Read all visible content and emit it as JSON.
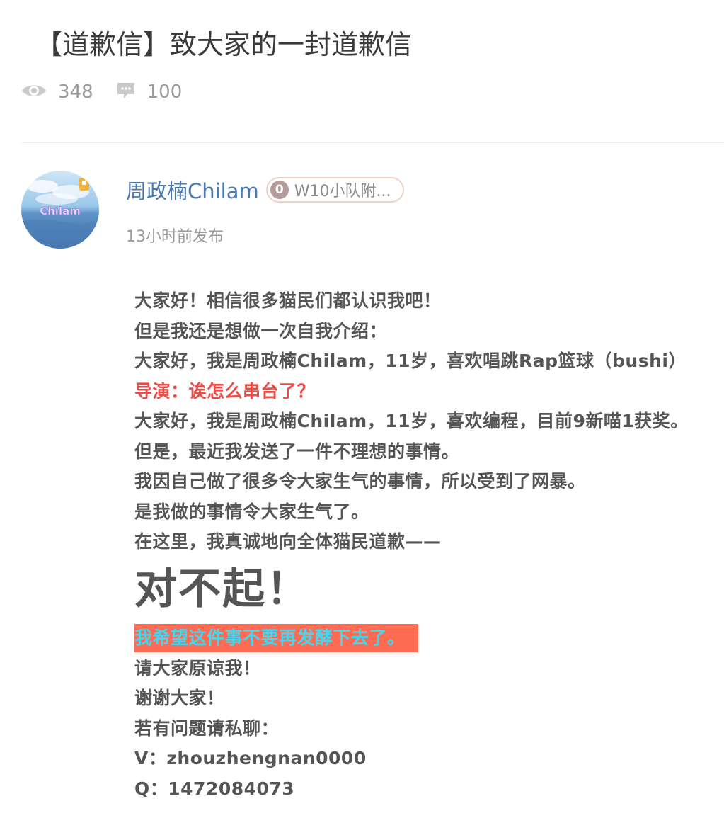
{
  "post": {
    "title": "【道歉信】致大家的一封道歉信",
    "views": "348",
    "comments": "100"
  },
  "author": {
    "name": "周政楠Chilam",
    "badge_num": "0",
    "badge_label": "W10小队附...",
    "avatar_text": "Chilam",
    "posted_time": "13小时前发布"
  },
  "content": {
    "l1": "大家好！相信很多猫民们都认识我吧！",
    "l2": "但是我还是想做一次自我介绍：",
    "l3": "大家好，我是周政楠Chilam，11岁，喜欢唱跳Rap篮球（bushi）",
    "l4": "导演：诶怎么串台了？",
    "l5": "大家好，我是周政楠Chilam，11岁，喜欢编程，目前9新喵1获奖。",
    "l6": "但是，最近我发送了一件不理想的事情。",
    "l7": "我因自己做了很多令大家生气的事情，所以受到了网暴。",
    "l8": "是我做的事情令大家生气了。",
    "l9": "在这里，我真诚地向全体猫民道歉——",
    "l10": "对不起！",
    "l11": "我希望这件事不要再发酵下去了。",
    "l12": "请大家原谅我！",
    "l13": "谢谢大家！",
    "l14": "若有问题请私聊：",
    "l15": "V：zhouzhengnan0000",
    "l16": "Q：1472084073"
  },
  "colors": {
    "author_name": "#4a78b0",
    "red_text": "#ee4b46",
    "highlight_bg": "#ff6b52",
    "highlight_text": "#45d6ee"
  },
  "icons": {
    "views": "eye-icon",
    "comments": "comment-bubble-icon"
  }
}
